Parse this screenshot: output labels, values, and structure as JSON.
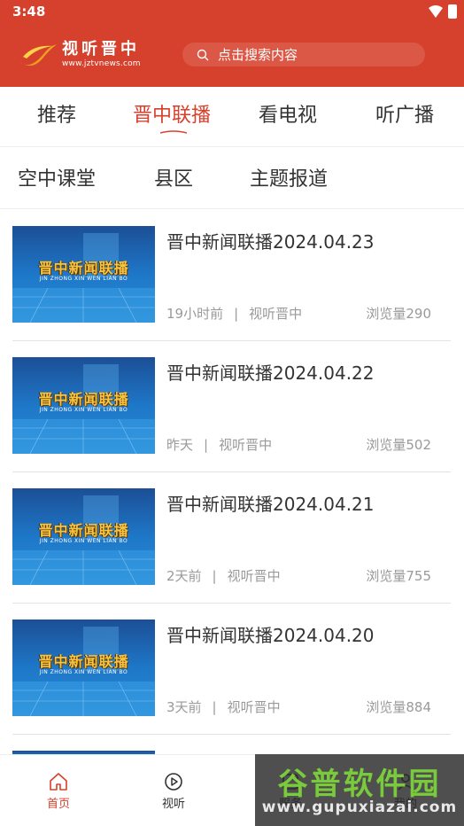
{
  "status_bar": {
    "time": "3:48"
  },
  "header": {
    "logo_title": "视听晋中",
    "logo_url": "www.jztvnews.com",
    "search_placeholder": "点击搜索内容",
    "brand_color": "#d6412d"
  },
  "tabs": [
    {
      "label": "推荐",
      "active": false
    },
    {
      "label": "晋中联播",
      "active": true
    },
    {
      "label": "看电视",
      "active": false
    },
    {
      "label": "听广播",
      "active": false
    }
  ],
  "subtabs": [
    {
      "label": "空中课堂"
    },
    {
      "label": "县区"
    },
    {
      "label": "主题报道"
    }
  ],
  "news": [
    {
      "title": "晋中新闻联播2024.04.23",
      "time": "19小时前",
      "source": "视听晋中",
      "views": "浏览量290",
      "thumb_title": "晋中新闻联播",
      "thumb_sub": "JIN ZHONG XIN WEN LIAN BO"
    },
    {
      "title": "晋中新闻联播2024.04.22",
      "time": "昨天",
      "source": "视听晋中",
      "views": "浏览量502",
      "thumb_title": "晋中新闻联播",
      "thumb_sub": "JIN ZHONG XIN WEN LIAN BO"
    },
    {
      "title": "晋中新闻联播2024.04.21",
      "time": "2天前",
      "source": "视听晋中",
      "views": "浏览量755",
      "thumb_title": "晋中新闻联播",
      "thumb_sub": "JIN ZHONG XIN WEN LIAN BO"
    },
    {
      "title": "晋中新闻联播2024.04.20",
      "time": "3天前",
      "source": "视听晋中",
      "views": "浏览量884",
      "thumb_title": "晋中新闻联播",
      "thumb_sub": "JIN ZHONG XIN WEN LIAN BO"
    }
  ],
  "bottom_nav": [
    {
      "label": "首页",
      "icon": "home-icon",
      "active": true
    },
    {
      "label": "视听",
      "icon": "play-circle-icon",
      "active": false
    },
    {
      "label": "服务",
      "icon": "service-icon",
      "active": false
    },
    {
      "label": "我的",
      "icon": "user-icon",
      "active": false
    }
  ],
  "watermark": {
    "text": "谷普软件园",
    "url": "www.gupuxiazai.com"
  }
}
